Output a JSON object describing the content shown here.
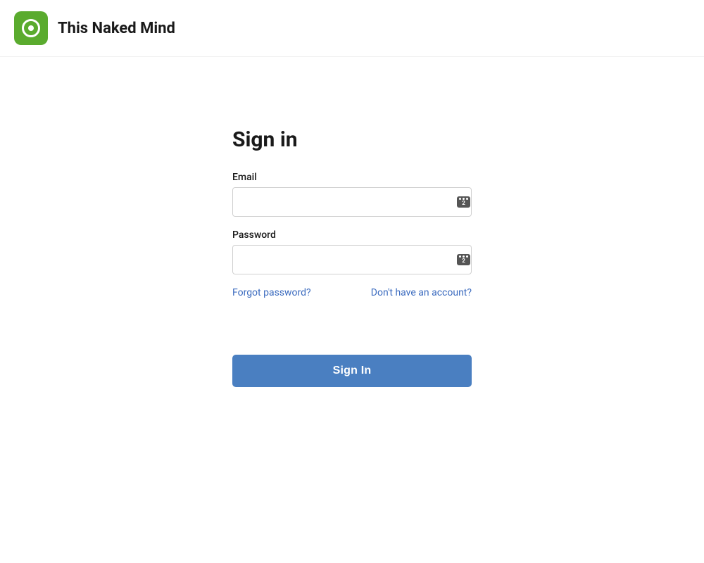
{
  "header": {
    "app_title": "This Naked Mind",
    "logo_alt": "This Naked Mind logo"
  },
  "form": {
    "heading": "Sign in",
    "email_label": "Email",
    "email_placeholder": "",
    "password_label": "Password",
    "password_placeholder": "",
    "forgot_password_label": "Forgot password?",
    "register_label": "Don't have an account?",
    "sign_in_button_label": "Sign In",
    "password_badge_count": "2"
  }
}
